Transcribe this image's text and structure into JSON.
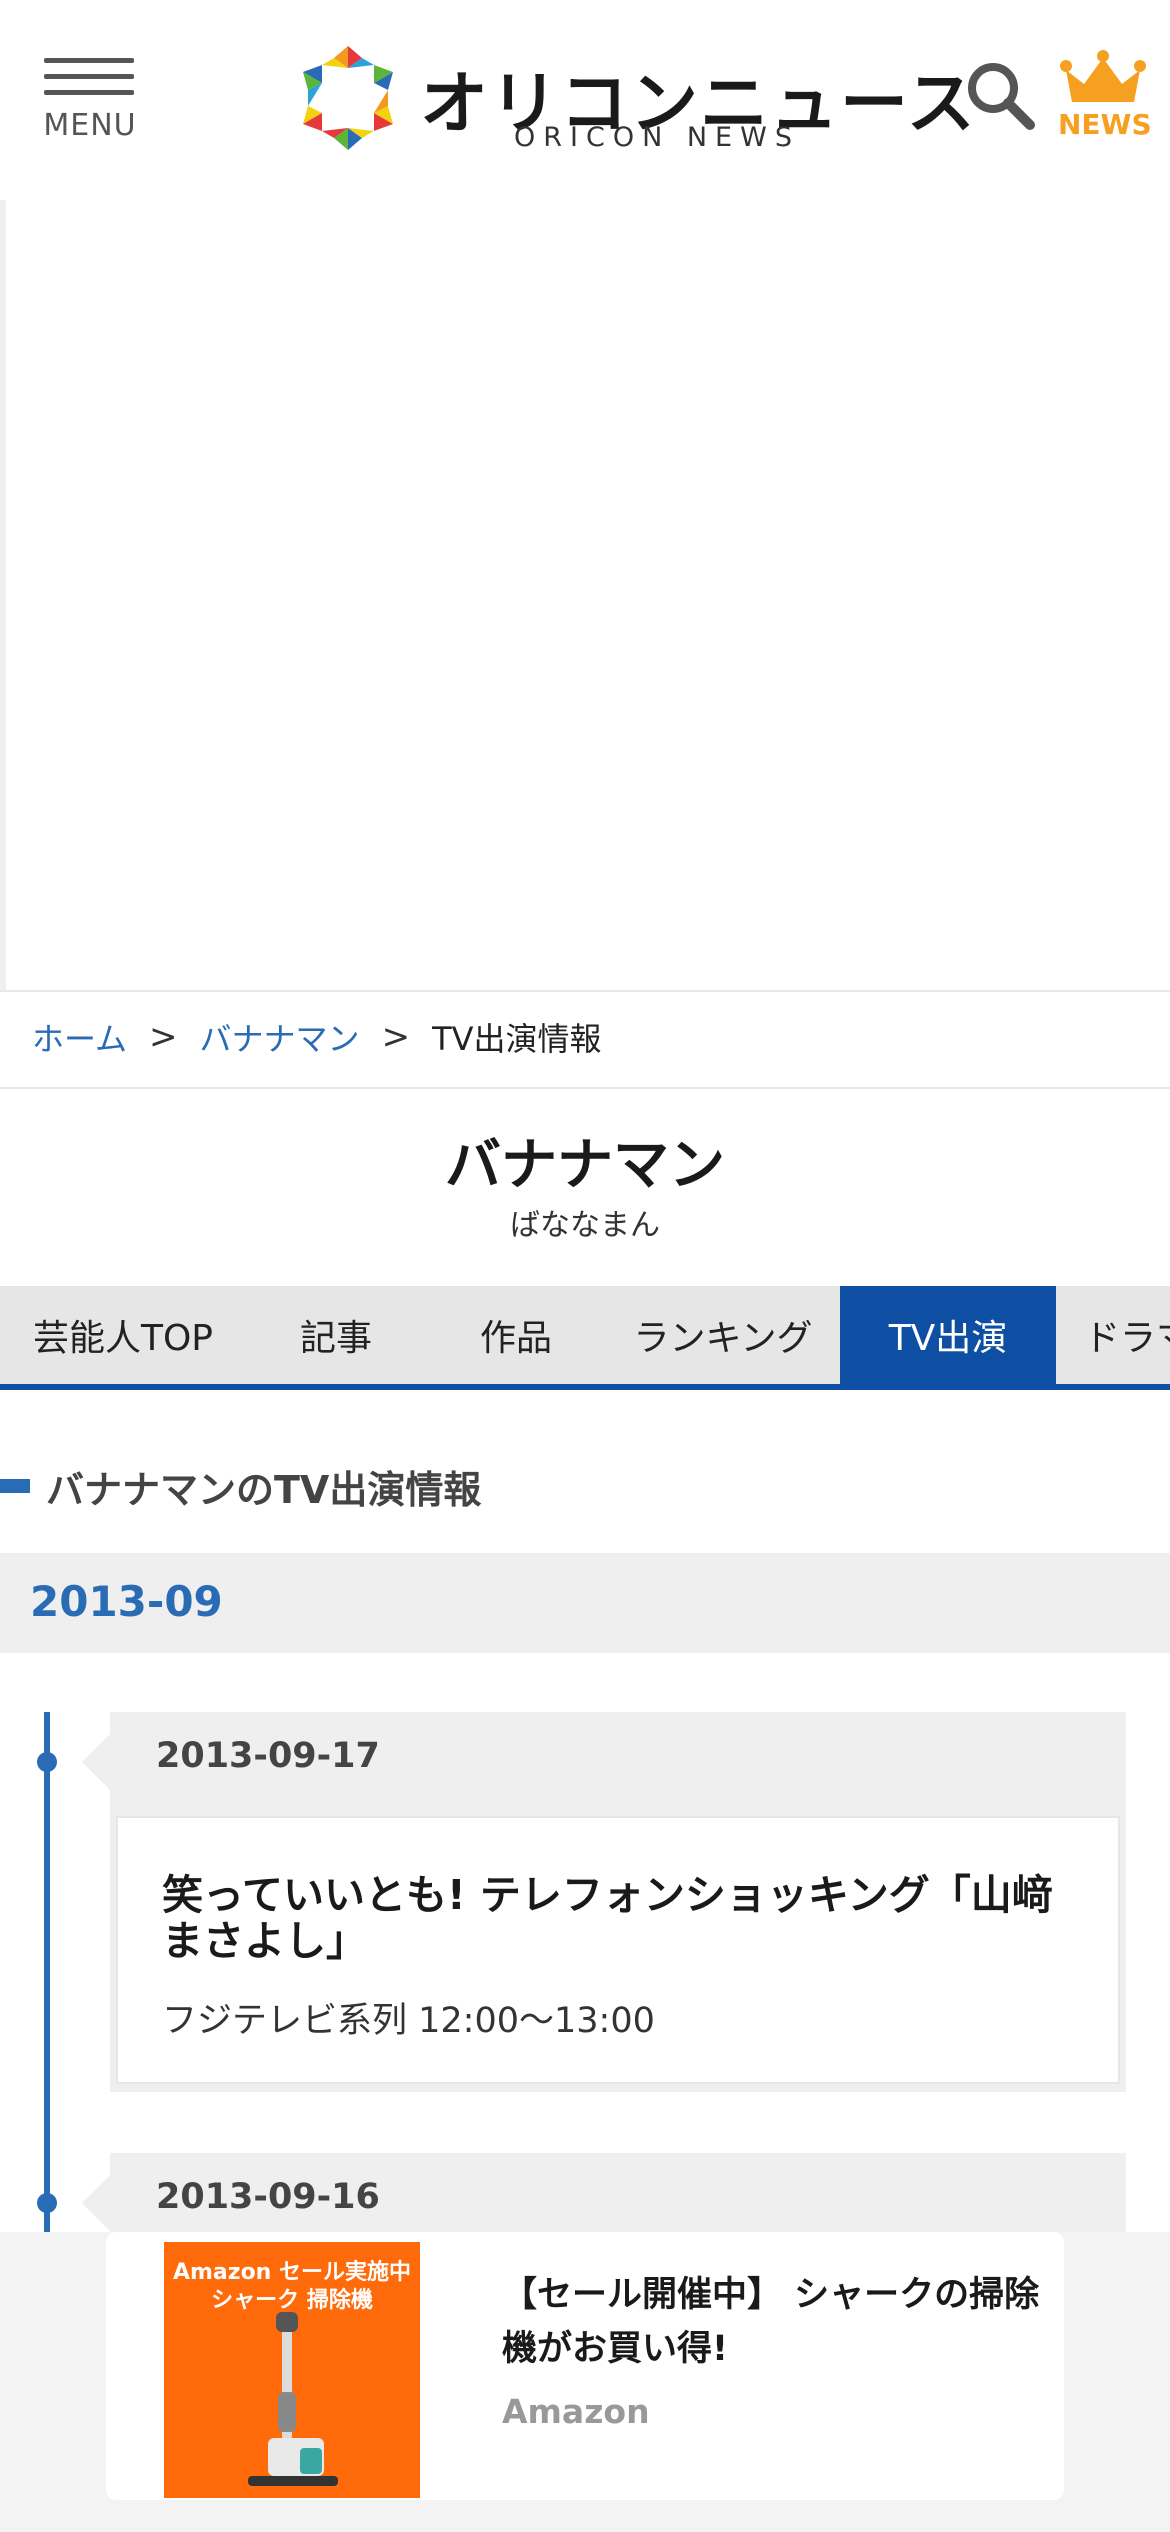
{
  "header": {
    "menu_label": "MENU",
    "logo_text": "オリコンニュース",
    "logo_sub": "ORICON NEWS",
    "news_label": "NEWS",
    "colors": {
      "news_accent": "#f5a020",
      "brand_blue": "#0e4fa3"
    }
  },
  "breadcrumb": {
    "home": "ホーム",
    "sep": ">",
    "artist": "バナナマン",
    "current": "TV出演情報"
  },
  "artist": {
    "name": "バナナマン",
    "kana": "ばななまん"
  },
  "tabs": [
    {
      "label": "芸能人TOP",
      "active": false
    },
    {
      "label": "記事",
      "active": false
    },
    {
      "label": "作品",
      "active": false
    },
    {
      "label": "ランキング",
      "active": false
    },
    {
      "label": "TV出演",
      "active": true
    },
    {
      "label": "ドラマ",
      "active": false
    }
  ],
  "section": {
    "heading": "バナナマンのTV出演情報",
    "month": "2013-09"
  },
  "entries": [
    {
      "date": "2013-09-17",
      "title": "笑っていいとも! テレフォンショッキング「山﨑まさよし」",
      "meta": "フジテレビ系列 12:00〜13:00"
    },
    {
      "date": "2013-09-16"
    }
  ],
  "bottom_ad": {
    "thumb_line1": "Amazon セール実施中",
    "thumb_line2": "シャーク 掃除機",
    "title": "【セール開催中】 シャークの掃除機がお買い得!",
    "source": "Amazon"
  }
}
